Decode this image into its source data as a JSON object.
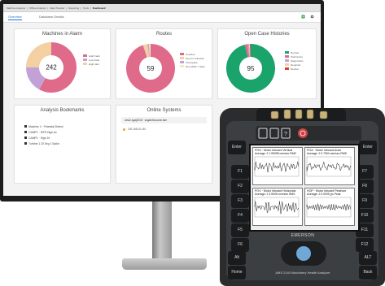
{
  "menubar": {
    "items": [
      "Machine Analysis",
      "Offline Analysis",
      "Data Transfer",
      "Reporting",
      "Tools",
      "Dashboard"
    ],
    "active_index": 5
  },
  "tabs": [
    {
      "label": "Overview",
      "active": true
    },
    {
      "label": "Database Details",
      "active": false
    }
  ],
  "toolbar": {
    "icons": [
      "export-icon",
      "settings-icon"
    ]
  },
  "cards": {
    "machines_in_alarm": {
      "title": "Machines in Alarm",
      "center_value": "242",
      "legend": [
        {
          "label": "High Fault",
          "color": "#e06a8a"
        },
        {
          "label": "Low Fault",
          "color": "#c2a2d6"
        },
        {
          "label": "High Alert",
          "color": "#f3cfa1"
        }
      ],
      "chart_data": {
        "type": "pie",
        "labels": [
          "High Fault",
          "Low Fault",
          "High Alert"
        ],
        "values": [
          0.58,
          0.17,
          0.25
        ]
      }
    },
    "routes": {
      "title": "Routes",
      "center_value": "59",
      "legend": [
        {
          "label": "Overdue",
          "color": "#e06a8a"
        },
        {
          "label": "Due for collection",
          "color": "#f3cfa1"
        },
        {
          "label": "Incomplete",
          "color": "#c2a2d6"
        },
        {
          "label": "Due within 7 days",
          "color": "#f7e8c0"
        }
      ],
      "chart_data": {
        "type": "pie",
        "labels": [
          "Overdue",
          "Due for collection",
          "Incomplete",
          "Due within 7 days"
        ],
        "values": [
          0.95,
          0.03,
          0.01,
          0.01
        ]
      }
    },
    "open_case_histories": {
      "title": "Open Case Histories",
      "center_value": "95",
      "legend": [
        {
          "label": "Normal",
          "color": "#1aa36a"
        },
        {
          "label": "Preliminary",
          "color": "#e06a8a"
        },
        {
          "label": "Diagnostics",
          "color": "#c2a2d6"
        },
        {
          "label": "Repaired",
          "color": "#f3cfa1"
        },
        {
          "label": "Review",
          "color": "#d93a3a"
        }
      ],
      "chart_data": {
        "type": "pie",
        "labels": [
          "Normal",
          "Preliminary",
          "Diagnostics",
          "Repaired",
          "Review"
        ],
        "values": [
          0.96,
          0.02,
          0.01,
          0.005,
          0.005
        ]
      }
    },
    "analysis_bookmarks": {
      "title": "Analysis Bookmarks",
      "items": [
        "Machine 4 · Potential Defect",
        "CAMP1 · MTR High Ax",
        "CAMP1 · High 2x",
        "Turbine 1 2X Brg 1 Spike"
      ]
    },
    "online_systems": {
      "title": "Online Systems",
      "header_row": "ams2-sgaj2018 · ssgainfosource.iam",
      "rows": [
        {
          "label": "192.168.10.140",
          "status_color": "#f0a020"
        }
      ]
    }
  },
  "device": {
    "brand": "EMERSON",
    "model": "AMS 2140 Machinery Health Analyzer",
    "left_keys": [
      "Enter",
      "F1",
      "F2",
      "F3",
      "F4",
      "F5",
      "F6",
      "Alt",
      "Home"
    ],
    "right_keys": [
      "Enter",
      "F7",
      "F8",
      "F9",
      "F10",
      "F11",
      "F12",
      "ALT",
      "Back"
    ],
    "panels": [
      {
        "title": "POH · Motor Inboard Vertical",
        "subtitle": "Average: 2    1.99095 mm/sec RMS"
      },
      {
        "title": "POA · Motor Inboard Axial",
        "subtitle": "Average: 2    0.7904 mm/sec RMS"
      },
      {
        "title": "POV · Motor Inboard Horizontal",
        "subtitle": "Average: 2    3.5H05 mm/sec RMS"
      },
      {
        "title": "HOP · Motor Inboard Peakvue",
        "subtitle": "Average: 2    0.0009 g's Peak"
      }
    ]
  }
}
